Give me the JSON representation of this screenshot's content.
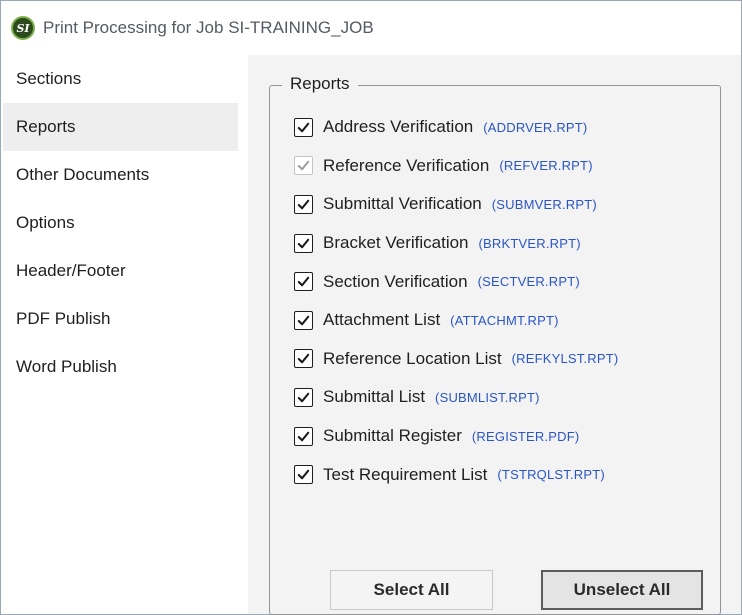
{
  "window": {
    "title": "Print Processing for Job SI-TRAINING_JOB",
    "app_icon_text": "SI"
  },
  "sidebar": {
    "items": [
      {
        "label": "Sections"
      },
      {
        "label": "Reports"
      },
      {
        "label": "Other Documents"
      },
      {
        "label": "Options"
      },
      {
        "label": "Header/Footer"
      },
      {
        "label": "PDF Publish"
      },
      {
        "label": "Word Publish"
      }
    ],
    "selected": "Reports"
  },
  "reports_group": {
    "legend": "Reports",
    "items": [
      {
        "name": "Address Verification",
        "file": "(ADDRVER.RPT)",
        "checked": true,
        "enabled": true
      },
      {
        "name": "Reference Verification",
        "file": "(REFVER.RPT)",
        "checked": true,
        "enabled": false
      },
      {
        "name": "Submittal Verification",
        "file": "(SUBMVER.RPT)",
        "checked": true,
        "enabled": true
      },
      {
        "name": "Bracket Verification",
        "file": "(BRKTVER.RPT)",
        "checked": true,
        "enabled": true
      },
      {
        "name": "Section Verification",
        "file": "(SECTVER.RPT)",
        "checked": true,
        "enabled": true
      },
      {
        "name": "Attachment List",
        "file": "(ATTACHMT.RPT)",
        "checked": true,
        "enabled": true
      },
      {
        "name": "Reference Location List",
        "file": "(REFKYLST.RPT)",
        "checked": true,
        "enabled": true
      },
      {
        "name": "Submittal List",
        "file": "(SUBMLIST.RPT)",
        "checked": true,
        "enabled": true
      },
      {
        "name": "Submittal Register",
        "file": "(REGISTER.PDF)",
        "checked": true,
        "enabled": true
      },
      {
        "name": "Test Requirement List",
        "file": "(TSTRQLST.RPT)",
        "checked": true,
        "enabled": true
      }
    ]
  },
  "buttons": {
    "select_all": "Select All",
    "unselect_all": "Unselect All"
  },
  "colors": {
    "file_link": "#2a55c7",
    "disabled_check": "#a0a0a0",
    "background": "#f3f3f3"
  }
}
